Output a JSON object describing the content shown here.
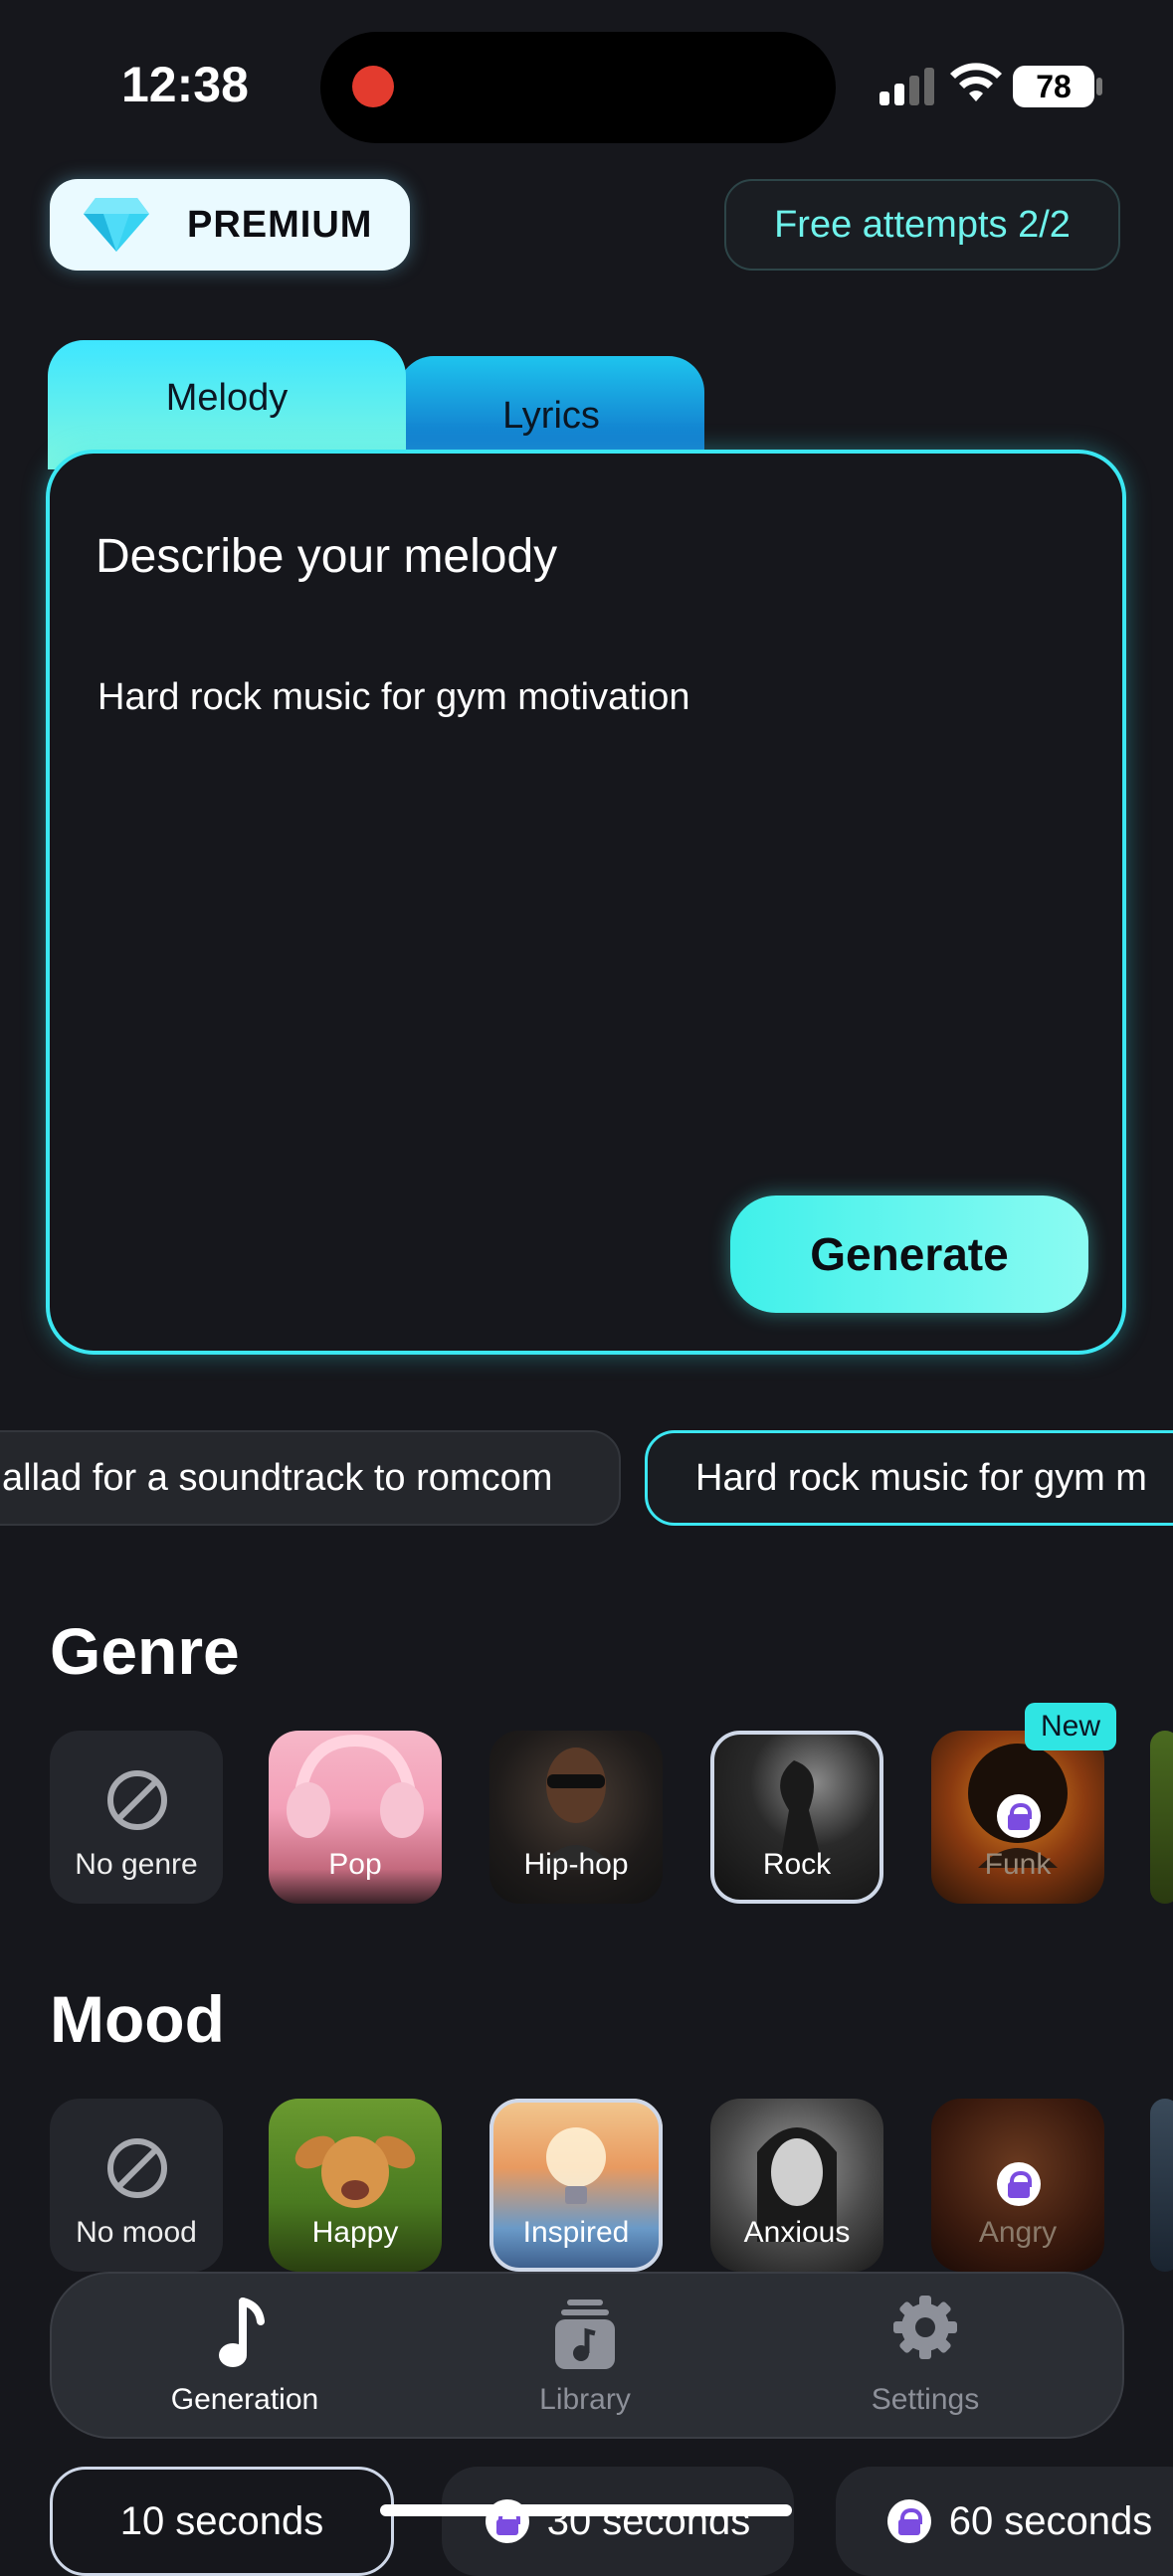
{
  "status": {
    "time": "12:38",
    "battery": "78"
  },
  "premium_label": "PREMIUM",
  "free_attempts": "Free attempts 2/2",
  "tabs": {
    "melody": "Melody",
    "lyrics": "Lyrics"
  },
  "card": {
    "title": "Describe your melody",
    "text": "Hard rock music for gym motivation",
    "generate": "Generate"
  },
  "suggestions": [
    "allad for a soundtrack to romcom",
    "Hard rock music for gym m"
  ],
  "genre": {
    "title": "Genre",
    "items": [
      "No genre",
      "Pop",
      "Hip-hop",
      "Rock",
      "Funk"
    ],
    "new_badge": "New"
  },
  "mood": {
    "title": "Mood",
    "items": [
      "No mood",
      "Happy",
      "Inspired",
      "Anxious",
      "Angry"
    ]
  },
  "tabbar": {
    "generation": "Generation",
    "library": "Library",
    "settings": "Settings"
  },
  "durations": [
    "10 seconds",
    "30 seconds",
    "60 seconds"
  ],
  "colors": {
    "accent": "#3be7f2",
    "background": "#16171c"
  }
}
